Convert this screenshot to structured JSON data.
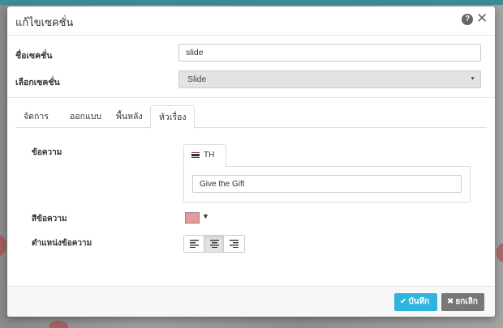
{
  "dialog": {
    "title": "แก้ไขเซคชั่น",
    "help_icon": "?",
    "close_icon": "✕"
  },
  "form": {
    "section_name_label": "ชื่อเซคชั่น",
    "section_name_value": "slide",
    "section_select_label": "เลือกเซคชั่น",
    "section_select_value": "Slide"
  },
  "tabs": [
    {
      "label": "จัดการ",
      "active": false
    },
    {
      "label": "ออกแบบ",
      "active": false
    },
    {
      "label": "พื้นหลัง",
      "active": false
    },
    {
      "label": "หัวเรื่อง",
      "active": true
    }
  ],
  "heading_panel": {
    "text_label": "ข้อความ",
    "language_tab": "TH",
    "text_value": "Give the Gift",
    "text_color_label": "สีข้อความ",
    "text_color": "#e99797",
    "alignment_label": "ตำแหน่งข้อความ",
    "alignment_options": [
      "left",
      "center",
      "right"
    ],
    "alignment_selected": "center"
  },
  "footer": {
    "save_label": "บันทึก",
    "save_icon": "✔",
    "cancel_label": "ยกเลิก",
    "cancel_icon": "✖"
  },
  "colors": {
    "save_button": "#2fb4de",
    "cancel_button": "#777777"
  }
}
